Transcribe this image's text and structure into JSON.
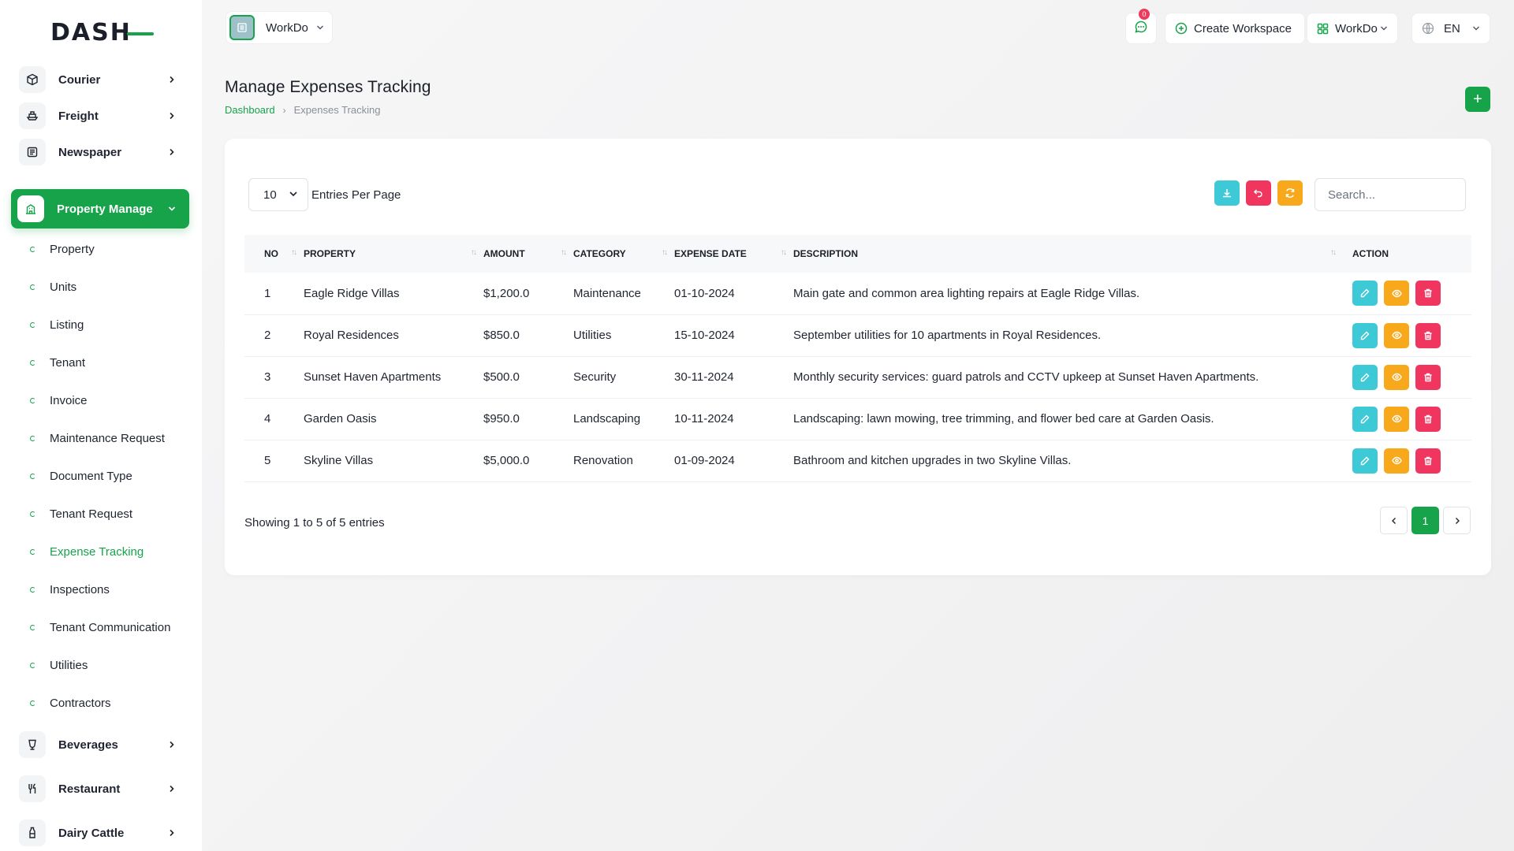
{
  "brand": {
    "logo_main": "DASH",
    "accent": "#16a34a"
  },
  "sidebar": {
    "modules": [
      {
        "label": "Courier",
        "icon": "box-icon"
      },
      {
        "label": "Freight",
        "icon": "ship-icon"
      },
      {
        "label": "Newspaper",
        "icon": "newspaper-icon"
      },
      {
        "label": "Property Manage",
        "icon": "building-icon",
        "active": true
      },
      {
        "label": "Beverages",
        "icon": "cup-icon"
      },
      {
        "label": "Restaurant",
        "icon": "utensils-icon"
      },
      {
        "label": "Dairy Cattle",
        "icon": "bottle-icon"
      }
    ],
    "submenu": [
      "Property",
      "Units",
      "Listing",
      "Tenant",
      "Invoice",
      "Maintenance Request",
      "Document Type",
      "Tenant Request",
      "Expense Tracking",
      "Inspections",
      "Tenant Communication",
      "Utilities",
      "Contractors"
    ],
    "active_sub": "Expense Tracking"
  },
  "topbar": {
    "workspace": "WorkDo",
    "notifications": "0",
    "create_workspace": "Create Workspace",
    "workspace_menu": "WorkDo",
    "language": "EN"
  },
  "page": {
    "title": "Manage Expenses Tracking",
    "breadcrumb": [
      "Dashboard",
      "Expenses Tracking"
    ],
    "add_label": "+"
  },
  "table_controls": {
    "per_page": "10",
    "per_page_label": "Entries Per Page",
    "search_placeholder": "Search..."
  },
  "table": {
    "headers": [
      "NO",
      "PROPERTY",
      "AMOUNT",
      "CATEGORY",
      "EXPENSE DATE",
      "DESCRIPTION",
      "ACTION"
    ],
    "rows": [
      {
        "no": "1",
        "property": "Eagle Ridge Villas",
        "amount": "$1,200.0",
        "category": "Maintenance",
        "date": "01-10-2024",
        "description": "Main gate and common area lighting repairs at Eagle Ridge Villas."
      },
      {
        "no": "2",
        "property": "Royal Residences",
        "amount": "$850.0",
        "category": "Utilities",
        "date": "15-10-2024",
        "description": "September utilities for 10 apartments in Royal Residences."
      },
      {
        "no": "3",
        "property": "Sunset Haven Apartments",
        "amount": "$500.0",
        "category": "Security",
        "date": "30-11-2024",
        "description": "Monthly security services: guard patrols and CCTV upkeep at Sunset Haven Apartments."
      },
      {
        "no": "4",
        "property": "Garden Oasis",
        "amount": "$950.0",
        "category": "Landscaping",
        "date": "10-11-2024",
        "description": "Landscaping: lawn mowing, tree trimming, and flower bed care at Garden Oasis."
      },
      {
        "no": "5",
        "property": "Skyline Villas",
        "amount": "$5,000.0",
        "category": "Renovation",
        "date": "01-09-2024",
        "description": "Bathroom and kitchen upgrades in two Skyline Villas."
      }
    ]
  },
  "footer": {
    "showing": "Showing 1 to 5 of 5 entries",
    "current_page": "1"
  },
  "colors": {
    "edit": "#3ec9d6",
    "view": "#f7a81b",
    "delete": "#f0365f",
    "primary": "#16a34a"
  }
}
